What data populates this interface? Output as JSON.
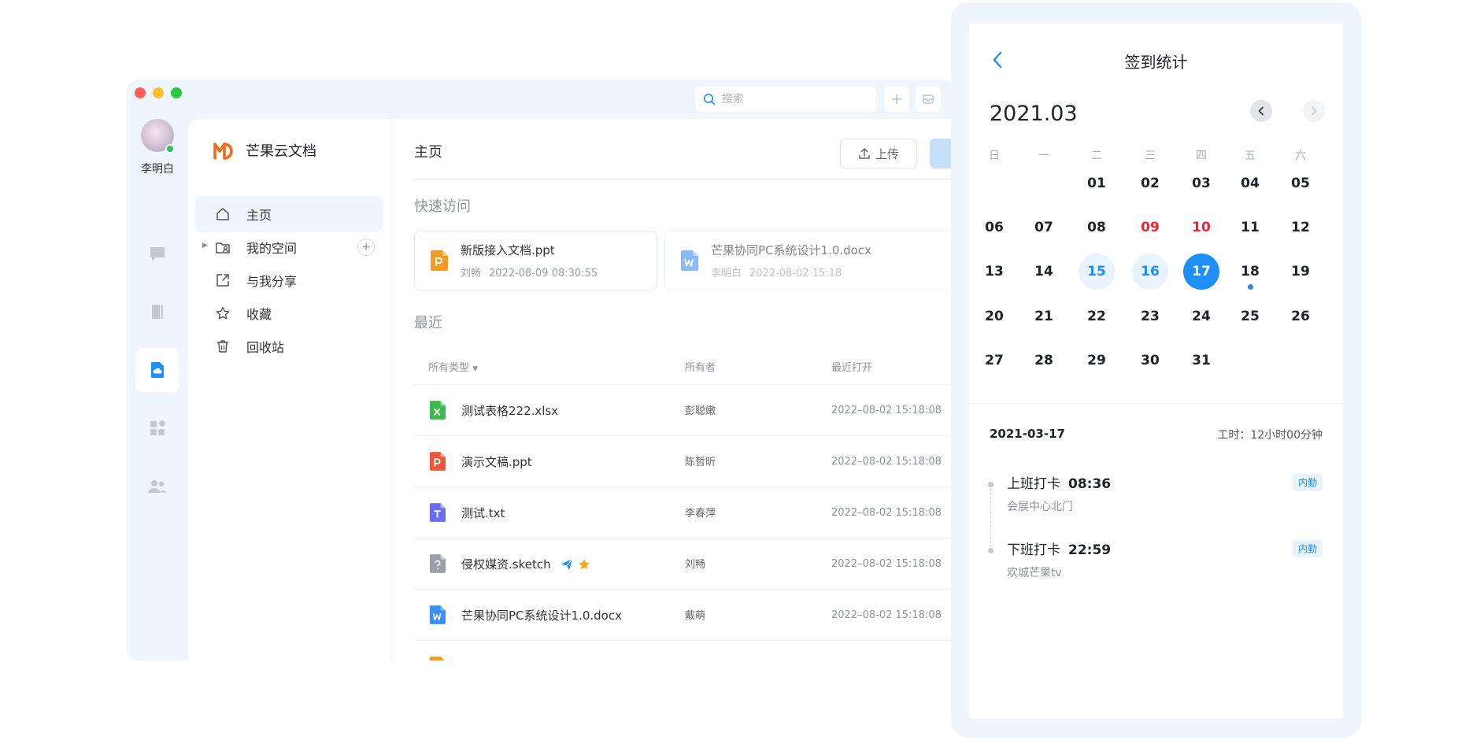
{
  "app": {
    "user_name": "李明白",
    "brand_name": "芒果云文档",
    "search_placeholder": "搜索"
  },
  "sidebar": {
    "items": [
      {
        "label": "主页",
        "icon": "home-icon"
      },
      {
        "label": "我的空间",
        "icon": "folder-user-icon"
      },
      {
        "label": "与我分享",
        "icon": "share-icon"
      },
      {
        "label": "收藏",
        "icon": "star-icon"
      },
      {
        "label": "回收站",
        "icon": "trash-icon"
      }
    ]
  },
  "main": {
    "title": "主页",
    "upload_label": "上传",
    "quick_access_title": "快速访问",
    "quick_access": [
      {
        "name": "新版接入文档.ppt",
        "owner": "刘畅",
        "time": "2022-08-09 08:30:55",
        "type": "ppt"
      },
      {
        "name": "芒果协同PC系统设计1.0.docx",
        "owner": "李明白",
        "time": "2022-08-02 15:18",
        "type": "docx"
      }
    ],
    "recent_title": "最近",
    "columns": {
      "type": "所有类型",
      "owner": "所有者",
      "opened": "最近打开"
    },
    "files": [
      {
        "name": "测试表格222.xlsx",
        "owner": "彭聪嫩",
        "time": "2022–08-02 15:18:08",
        "type": "xlsx"
      },
      {
        "name": "演示文稿.ppt",
        "owner": "陈哲昕",
        "time": "2022–08-02 15:18:08",
        "type": "ppt"
      },
      {
        "name": "测试.txt",
        "owner": "李春萍",
        "time": "2022–08-02 15:18:08",
        "type": "txt"
      },
      {
        "name": "侵权媒资.sketch",
        "owner": "刘畅",
        "time": "2022–08-02 15:18:08",
        "type": "sketch"
      },
      {
        "name": "芒果协同PC系统设计1.0.docx",
        "owner": "戴萌",
        "time": "2022–08-02 15:18:08",
        "type": "docx"
      }
    ]
  },
  "calendar": {
    "title": "签到统计",
    "month": "2021.03",
    "weekdays": [
      "日",
      "一",
      "二",
      "三",
      "四",
      "五",
      "六"
    ],
    "days": [
      "01",
      "02",
      "03",
      "04",
      "05",
      "06",
      "07",
      "08",
      "09",
      "10",
      "11",
      "12",
      "13",
      "14",
      "15",
      "16",
      "17",
      "18",
      "19",
      "20",
      "21",
      "22",
      "23",
      "24",
      "25",
      "26",
      "27",
      "28",
      "29",
      "30",
      "31"
    ],
    "first_weekday": 2,
    "red_days": [
      "09",
      "10"
    ],
    "light_days": [
      "15",
      "16"
    ],
    "selected_day": "17",
    "dot_days": [
      "18"
    ],
    "selected_date": "2021-03-17",
    "work_hours": "工时：12小时00分钟",
    "records": [
      {
        "label": "上班打卡",
        "time": "08:36",
        "location": "会展中心北门",
        "tag": "内勤"
      },
      {
        "label": "下班打卡",
        "time": "22:59",
        "location": "欢城芒果tv",
        "tag": "内勤"
      }
    ]
  },
  "colors": {
    "accent": "#1e90f5",
    "weekend_red": "#f5222d",
    "brand_orange": "#f26b1d"
  }
}
